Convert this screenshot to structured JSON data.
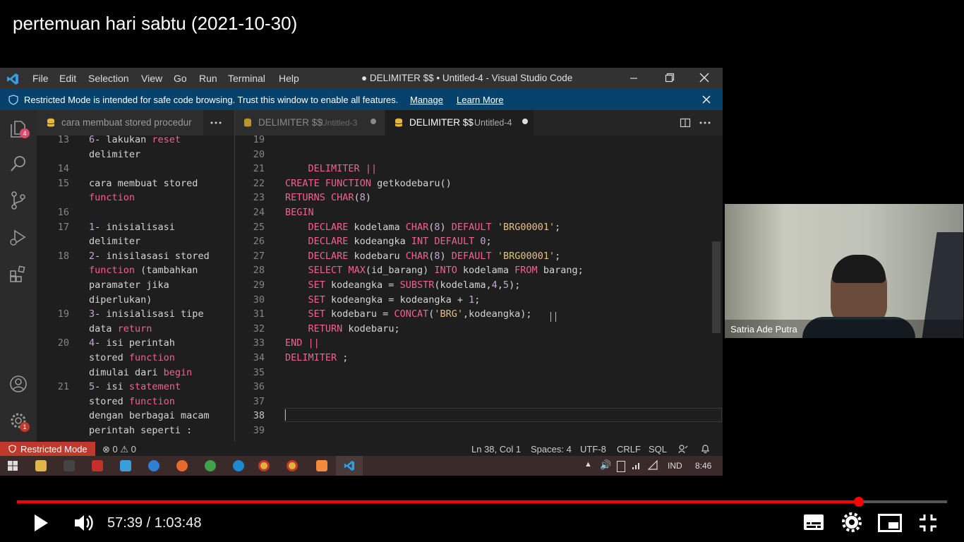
{
  "video": {
    "title": "pertemuan hari sabtu (2021-10-30)",
    "time_current": "57:39",
    "time_separator": "/",
    "time_total": "1:03:48",
    "progress": 0.905
  },
  "vscode": {
    "menu": [
      "File",
      "Edit",
      "Selection",
      "View",
      "Go",
      "Run",
      "Terminal",
      "Help"
    ],
    "window_title": "● DELIMITER $$ • Untitled-4 - Visual Studio Code",
    "banner": {
      "text": "Restricted Mode is intended for safe code browsing. Trust this window to enable all features.",
      "manage": "Manage",
      "learn_more": "Learn More"
    },
    "badges": {
      "explorer": "4",
      "settings": "1"
    },
    "tabs_left": {
      "active": "cara membuat stored procedur"
    },
    "tabs_right": [
      {
        "name": "DELIMITER $$",
        "file": "Untitled-3"
      },
      {
        "name": "DELIMITER $$",
        "file": "Untitled-4"
      }
    ],
    "left_lines": [
      {
        "n": "13",
        "text": "6- lakukan reset"
      },
      {
        "n": "",
        "text": "delimiter"
      },
      {
        "n": "14",
        "text": ""
      },
      {
        "n": "15",
        "text": "cara membuat stored"
      },
      {
        "n": "",
        "text": "function"
      },
      {
        "n": "16",
        "text": ""
      },
      {
        "n": "17",
        "text": "1- inisialisasi"
      },
      {
        "n": "",
        "text": "delimiter"
      },
      {
        "n": "18",
        "text": "2- inisilasasi stored"
      },
      {
        "n": "",
        "text": "function (tambahkan"
      },
      {
        "n": "",
        "text": "paramater jika"
      },
      {
        "n": "",
        "text": "diperlukan)"
      },
      {
        "n": "19",
        "text": "3- inisialisasi tipe"
      },
      {
        "n": "",
        "text": "data return"
      },
      {
        "n": "20",
        "text": "4- isi perintah"
      },
      {
        "n": "",
        "text": "stored function"
      },
      {
        "n": "",
        "text": "dimulai dari begin"
      },
      {
        "n": "21",
        "text": "5- isi statement"
      },
      {
        "n": "",
        "text": "stored function"
      },
      {
        "n": "",
        "text": "dengan berbagai macam"
      },
      {
        "n": "",
        "text": "perintah seperti :"
      }
    ],
    "code_lines": [
      {
        "n": "19",
        "text": ""
      },
      {
        "n": "20",
        "text": ""
      },
      {
        "n": "21",
        "text": "    DELIMITER ||"
      },
      {
        "n": "22",
        "text": "CREATE FUNCTION getkodebaru()"
      },
      {
        "n": "23",
        "text": "RETURNS CHAR(8)"
      },
      {
        "n": "24",
        "text": "BEGIN"
      },
      {
        "n": "25",
        "text": "    DECLARE kodelama CHAR(8) DEFAULT 'BRG00001';"
      },
      {
        "n": "26",
        "text": "    DECLARE kodeangka INT DEFAULT 0;"
      },
      {
        "n": "27",
        "text": "    DECLARE kodebaru CHAR(8) DEFAULT 'BRG00001';"
      },
      {
        "n": "28",
        "text": "    SELECT MAX(id_barang) INTO kodelama FROM barang;"
      },
      {
        "n": "29",
        "text": "    SET kodeangka = SUBSTR(kodelama,4,5);"
      },
      {
        "n": "30",
        "text": "    SET kodeangka = kodeangka + 1;"
      },
      {
        "n": "31",
        "text": "    SET kodebaru = CONCAT('BRG',kodeangka);"
      },
      {
        "n": "32",
        "text": "    RETURN kodebaru;"
      },
      {
        "n": "33",
        "text": "END ||"
      },
      {
        "n": "34",
        "text": "DELIMITER ;"
      },
      {
        "n": "35",
        "text": ""
      },
      {
        "n": "36",
        "text": ""
      },
      {
        "n": "37",
        "text": ""
      },
      {
        "n": "38",
        "text": ""
      },
      {
        "n": "39",
        "text": ""
      }
    ],
    "status": {
      "restricted": "Restricted Mode",
      "problems": "⊗ 0 ⚠ 0",
      "position": "Ln 38, Col 1",
      "spaces": "Spaces: 4",
      "encoding": "UTF-8",
      "eol": "CRLF",
      "language": "SQL"
    },
    "taskbar": {
      "lang": "IND",
      "clock": "8:46"
    }
  },
  "webcam": {
    "name": "Satria Ade Putra"
  },
  "colors": {
    "progress": "#ff0000",
    "banner": "#06426b",
    "restricted": "#c0392b"
  }
}
